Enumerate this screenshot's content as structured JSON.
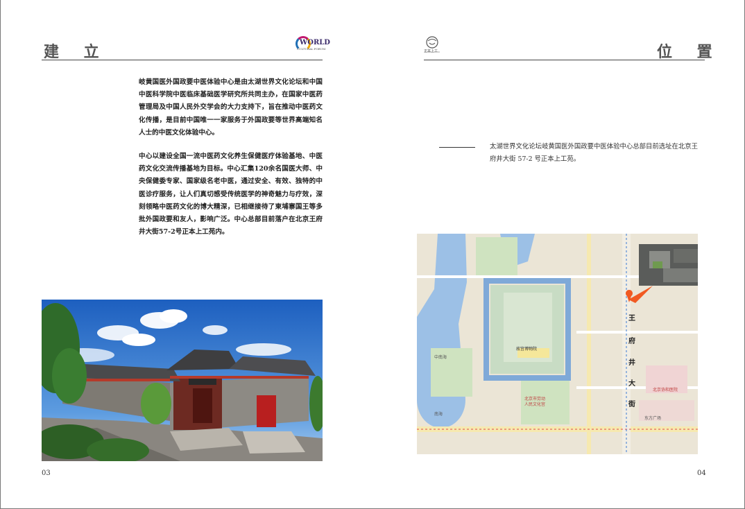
{
  "left_page": {
    "title": "建  立",
    "logo_text": "WORLD",
    "logo_subtext": "CULTURAL FORUM",
    "paragraph1": "岐黄国医外国政要中医体验中心是由太湖世界文化论坛和中国中医科学院中医临床基础医学研究所共同主办，在国家中医药管理局及中国人民外交学会的大力支持下，旨在推动中医药文化传播，是目前中国唯一一家服务于外国政要等世界高端知名人士的中医文化体验中心。",
    "paragraph2": "中心以建设全国一流中医药文化养生保健医疗体验基地、中医药文化交流传播基地为目标。中心汇集120余名国医大师、中央保健委专家、国家级名老中医，通过安全、有效、独特的中医诊疗服务，让人们真切感受传统医学的神奇魅力与疗效，深刻领略中医药文化的博大精深，已相继接待了柬埔寨国王等多批外国政要和友人，影响广泛。中心总部目前落户在北京王府井大街57-2号正本上工苑内。",
    "page_number": "03"
  },
  "right_page": {
    "title": "位  置",
    "logo_caption": "正本上工",
    "location_text": "太湖世界文化论坛岐黄国医外国政要中医体验中心总部目前选址在北京王府井大街 57-2 号正本上工苑。",
    "map_labels": {
      "palace": "故宫博物院",
      "street": [
        "王",
        "府",
        "井",
        "大",
        "街"
      ],
      "south_lake": "南海",
      "park": "北京市劳动人民文化宫",
      "hospital": "北京协和医院",
      "square": "东方广场",
      "lake": "中南海"
    },
    "page_number": "04"
  },
  "colors": {
    "map_bg": "#ebe5d6",
    "water": "#9cc0e6",
    "moat": "#7fa9d8",
    "green": "#cfe3c0",
    "marker": "#f15a22",
    "sky": "#2f72c9"
  }
}
